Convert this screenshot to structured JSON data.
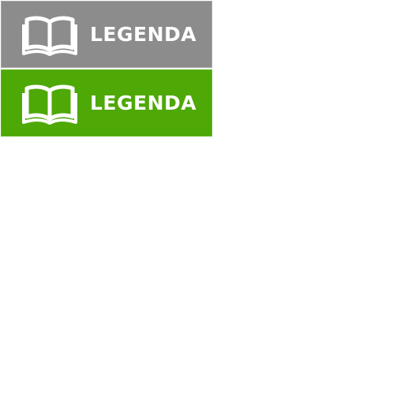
{
  "buttons": [
    {
      "state": "normal",
      "label": "LEGENDA",
      "icon": "open-book-icon",
      "background": "#8c8c8c"
    },
    {
      "state": "hover",
      "label": "LEGENDA",
      "icon": "open-book-icon",
      "background": "#4ea806"
    }
  ],
  "colors": {
    "text": "#ffffff",
    "page_background": "#ffffff"
  }
}
